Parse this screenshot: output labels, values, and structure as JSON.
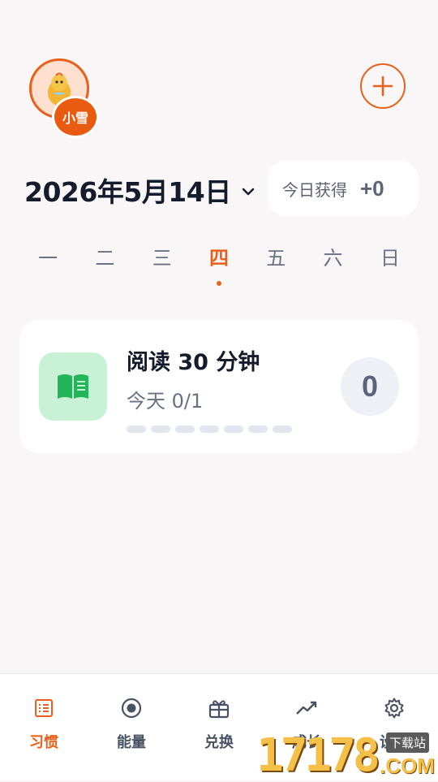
{
  "user": {
    "name": "小雪"
  },
  "header": {
    "date": "2026年5月14日",
    "earned_label": "今日获得",
    "earned_value": "+0"
  },
  "week": {
    "days": [
      "一",
      "二",
      "三",
      "四",
      "五",
      "六",
      "日"
    ],
    "selected_index": 3
  },
  "habit": {
    "title": "阅读 30 分钟",
    "progress": "今天 0/1",
    "count": "0",
    "streak_segments": 7,
    "icon": "book-icon"
  },
  "tabs": [
    {
      "label": "习惯",
      "icon": "list-icon",
      "active": true
    },
    {
      "label": "能量",
      "icon": "target-icon",
      "active": false
    },
    {
      "label": "兑换",
      "icon": "gift-icon",
      "active": false
    },
    {
      "label": "成长",
      "icon": "trend-icon",
      "active": false
    },
    {
      "label": "设置",
      "icon": "gear-icon",
      "active": false
    }
  ],
  "watermark": {
    "number": "17178",
    "tag": "下载站",
    "domain": ".COM"
  },
  "colors": {
    "accent": "#e9601b",
    "habit_bg": "#c9f1d6",
    "habit_icon": "#22b55a"
  }
}
